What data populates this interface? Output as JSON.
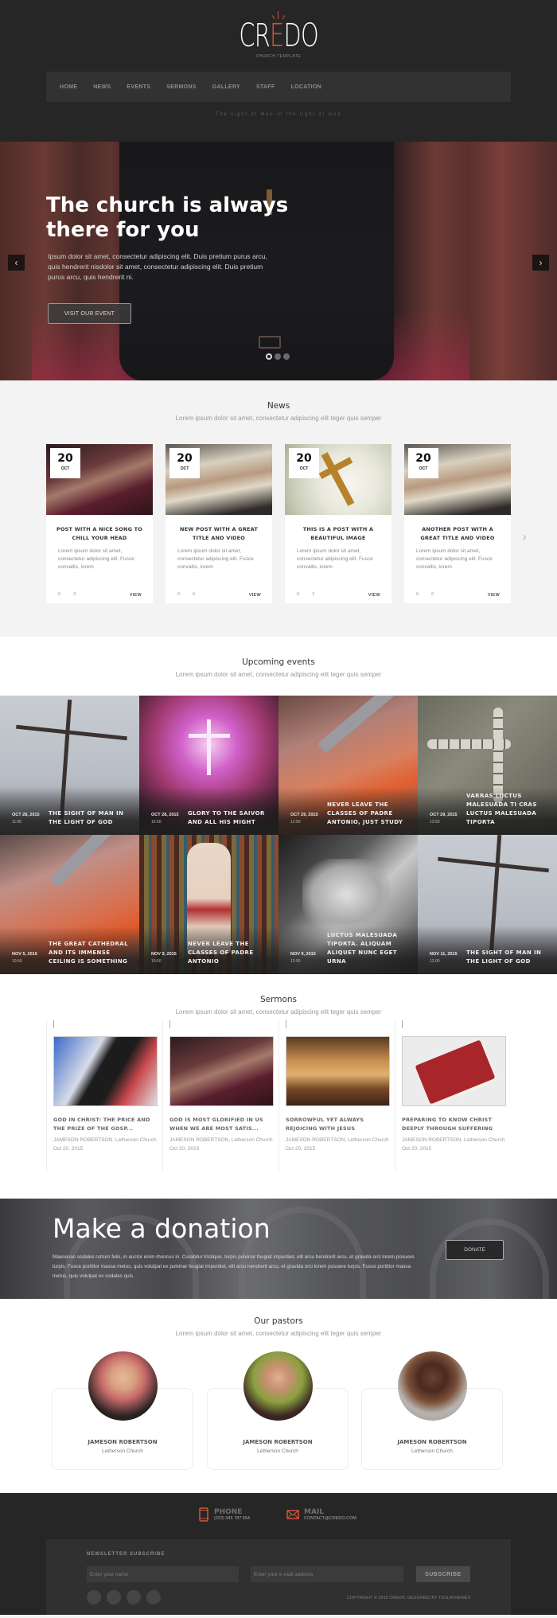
{
  "header": {
    "logo": {
      "pre": "CR",
      "accent": "E",
      "post": "DO",
      "subtitle": "CHURCH TEMPLATE"
    },
    "nav": [
      "HOME",
      "NEWS",
      "EVENTS",
      "SERMONS",
      "GALLERY",
      "STAFF",
      "LOCATION"
    ],
    "tagline": "The sight of Man in the light of God"
  },
  "hero": {
    "title": "The church is always there for you",
    "text": "Ipsum dolor sit amet, consectetur adipiscing elit. Duis pretium purus arcu, quis hendrerit nisdolor sit amet, consectetur adipiscing elit. Duis pretium purus arcu, quis hendrerit ni.",
    "button": "VISIT OUR EVENT",
    "prev_icon": "‹",
    "next_icon": "›",
    "slides_total": 3,
    "slide_active": 1
  },
  "news": {
    "title": "News",
    "subtitle": "Lorem ipsum dolor sit amet, consectetur adipiscing elit teger quis semper",
    "next_icon": "›",
    "items": [
      {
        "day": "20",
        "month": "OCT",
        "title": "POST WITH A NICE SONG TO CHILL YOUR HEAD",
        "excerpt": "Lorem ipsum dolor sit amet, consectetur adipiscing elit. Fusce convallis, lorem",
        "comments": "0",
        "likes": "3",
        "view": "VIEW",
        "image": "joined-hands"
      },
      {
        "day": "20",
        "month": "OCT",
        "title": "NEW POST WITH A GREAT TITLE AND VIDEO",
        "excerpt": "Lorem ipsum dolor sit amet, consectetur adipiscing elit. Fusce convallis, lorem",
        "comments": "0",
        "likes": "6",
        "view": "VIEW",
        "image": "hand-on-bible"
      },
      {
        "day": "20",
        "month": "OCT",
        "title": "THIS IS A POST WITH A BEAUTIFUL IMAGE",
        "excerpt": "Lorem ipsum dolor sit amet, consectetur adipiscing elit. Fusce convallis, lorem",
        "comments": "0",
        "likes": "3",
        "view": "VIEW",
        "image": "cross-on-lilies"
      },
      {
        "day": "20",
        "month": "OCT",
        "title": "ANOTHER POST WITH A GREAT TITLE AND VIDEO",
        "excerpt": "Lorem ipsum dolor sit amet, consectetur adipiscing elit. Fusce convallis, lorem",
        "comments": "0",
        "likes": "0",
        "view": "VIEW",
        "image": "hand-on-bible"
      }
    ]
  },
  "events": {
    "title": "Upcoming events",
    "subtitle": "Lorem ipsum dolor sit amet, consectetur adipiscing elit teger quis semper",
    "items": [
      {
        "date": "OCT 28, 2015",
        "time": "11:00",
        "title": "THE SIGHT OF MAN IN THE LIGHT OF GOD",
        "image": "wooden-cross-sky"
      },
      {
        "date": "OCT 28, 2015",
        "time": "16:50",
        "title": "GLORY TO THE SAIVOR AND ALL HIS MIGHT",
        "image": "concert-cross"
      },
      {
        "date": "OCT 29, 2015",
        "time": "12:50",
        "title": "NEVER LEAVE THE CLASSES OF PADRE ANTONIO, JUST STUDY",
        "image": "grill-tongs"
      },
      {
        "date": "OCT 29, 2015",
        "time": "13:50",
        "title": "VARRAS LUCTUS MALESUADA TI CRAS LUCTUS MALESUADA TIPORTA",
        "image": "stone-cross"
      },
      {
        "date": "NOV 5, 2015",
        "time": "10:50",
        "title": "THE GREAT CATHEDRAL AND ITS IMMENSE CEILING IS SOMETHING",
        "image": "grill-tongs"
      },
      {
        "date": "NOV 9, 2015",
        "time": "10:50",
        "title": "NEVER LEAVE THE CLASSES OF PADRE ANTONIO",
        "image": "stained-glass"
      },
      {
        "date": "NOV 9, 2015",
        "time": "12:50",
        "title": "LUCTUS MALESUADA TIPORTA. ALIQUAM ALIQUET NUNC EGET URNA",
        "image": "holding-hands"
      },
      {
        "date": "NOV 11, 2015",
        "time": "12:00",
        "title": "THE SIGHT OF MAN IN THE LIGHT OF GOD",
        "image": "wooden-cross-sky"
      }
    ]
  },
  "sermons": {
    "title": "Sermons",
    "subtitle": "Lorem ipsum dolor sit amet, consectetur adipiscing elit teger quis semper",
    "items": [
      {
        "title": "GOD IN CHRIST: THE PRICE AND THE PRIZE OF THE GOSP...",
        "author": "JAMESON ROBERTSON, Letherson Church",
        "date": "Oct 20, 2015",
        "image": "bible-in-hands"
      },
      {
        "title": "GOD IS MOST GLORIFIED IN US WHEN WE ARE MOST SATIS...",
        "author": "JAMESON ROBERTSON, Letherson Church",
        "date": "Oct 20, 2015",
        "image": "joined-hands"
      },
      {
        "title": "SORROWFUL YET ALWAYS REJOICING WITH JESUS",
        "author": "JAMESON ROBERTSON, Letherson Church",
        "date": "Oct 20, 2015",
        "image": "cathedral-interior"
      },
      {
        "title": "PREPARING TO KNOW CHRIST DEEPLY THROUGH SUFFERING",
        "author": "JAMESON ROBERTSON, Letherson Church",
        "date": "Oct 20, 2015",
        "image": "holy-bible"
      }
    ]
  },
  "donation": {
    "title": "Make a donation",
    "text": "Maecenas sodales rutrum felis, in auctor enim rhoncus in. Curabitur tristique, turpis pulvinar feugiat imperdiet, elit arcu hendrerit arcu, et gravida orci lorem posuere turpis. Fusce porttitor massa metus, quis volutpat ex pulvinar feugiat imperdiet, elit arcu hendrerit arcu, et gravida orci lorem posuere turpis. Fusce porttitor massa metus, quis volutpat ex sodales quis.",
    "button": "DONATE"
  },
  "pastors": {
    "title": "Our pastors",
    "subtitle": "Lorem ipsum dolor sit amet, consectetur adipiscing elit teger quis semper",
    "items": [
      {
        "name": "JAMESON ROBERTSON",
        "church": "Letherson Church"
      },
      {
        "name": "JAMESON ROBERTSON",
        "church": "Letherson Church"
      },
      {
        "name": "JAMESON ROBERTSON",
        "church": "Letherson Church"
      }
    ]
  },
  "footer": {
    "phone": {
      "label": "PHONE",
      "value": "(222) 345 787 654"
    },
    "mail": {
      "label": "MAIL",
      "value": "CONTACT@CREDO.COM"
    },
    "newsletter": {
      "title": "NEWSLETTER SUBSCRIBE",
      "name_placeholder": "Enter your name",
      "email_placeholder": "Enter your e-mail address",
      "button": "SUBSCRIBE"
    },
    "socials": [
      "social-1",
      "social-2",
      "social-3",
      "social-4"
    ],
    "copyright": "COPYRIGHT © 2015 CREDO. DESIGNED BY TESLATHEMES"
  },
  "colors": {
    "accent": "#d0553a",
    "dark": "#262626",
    "panel": "#303030"
  }
}
